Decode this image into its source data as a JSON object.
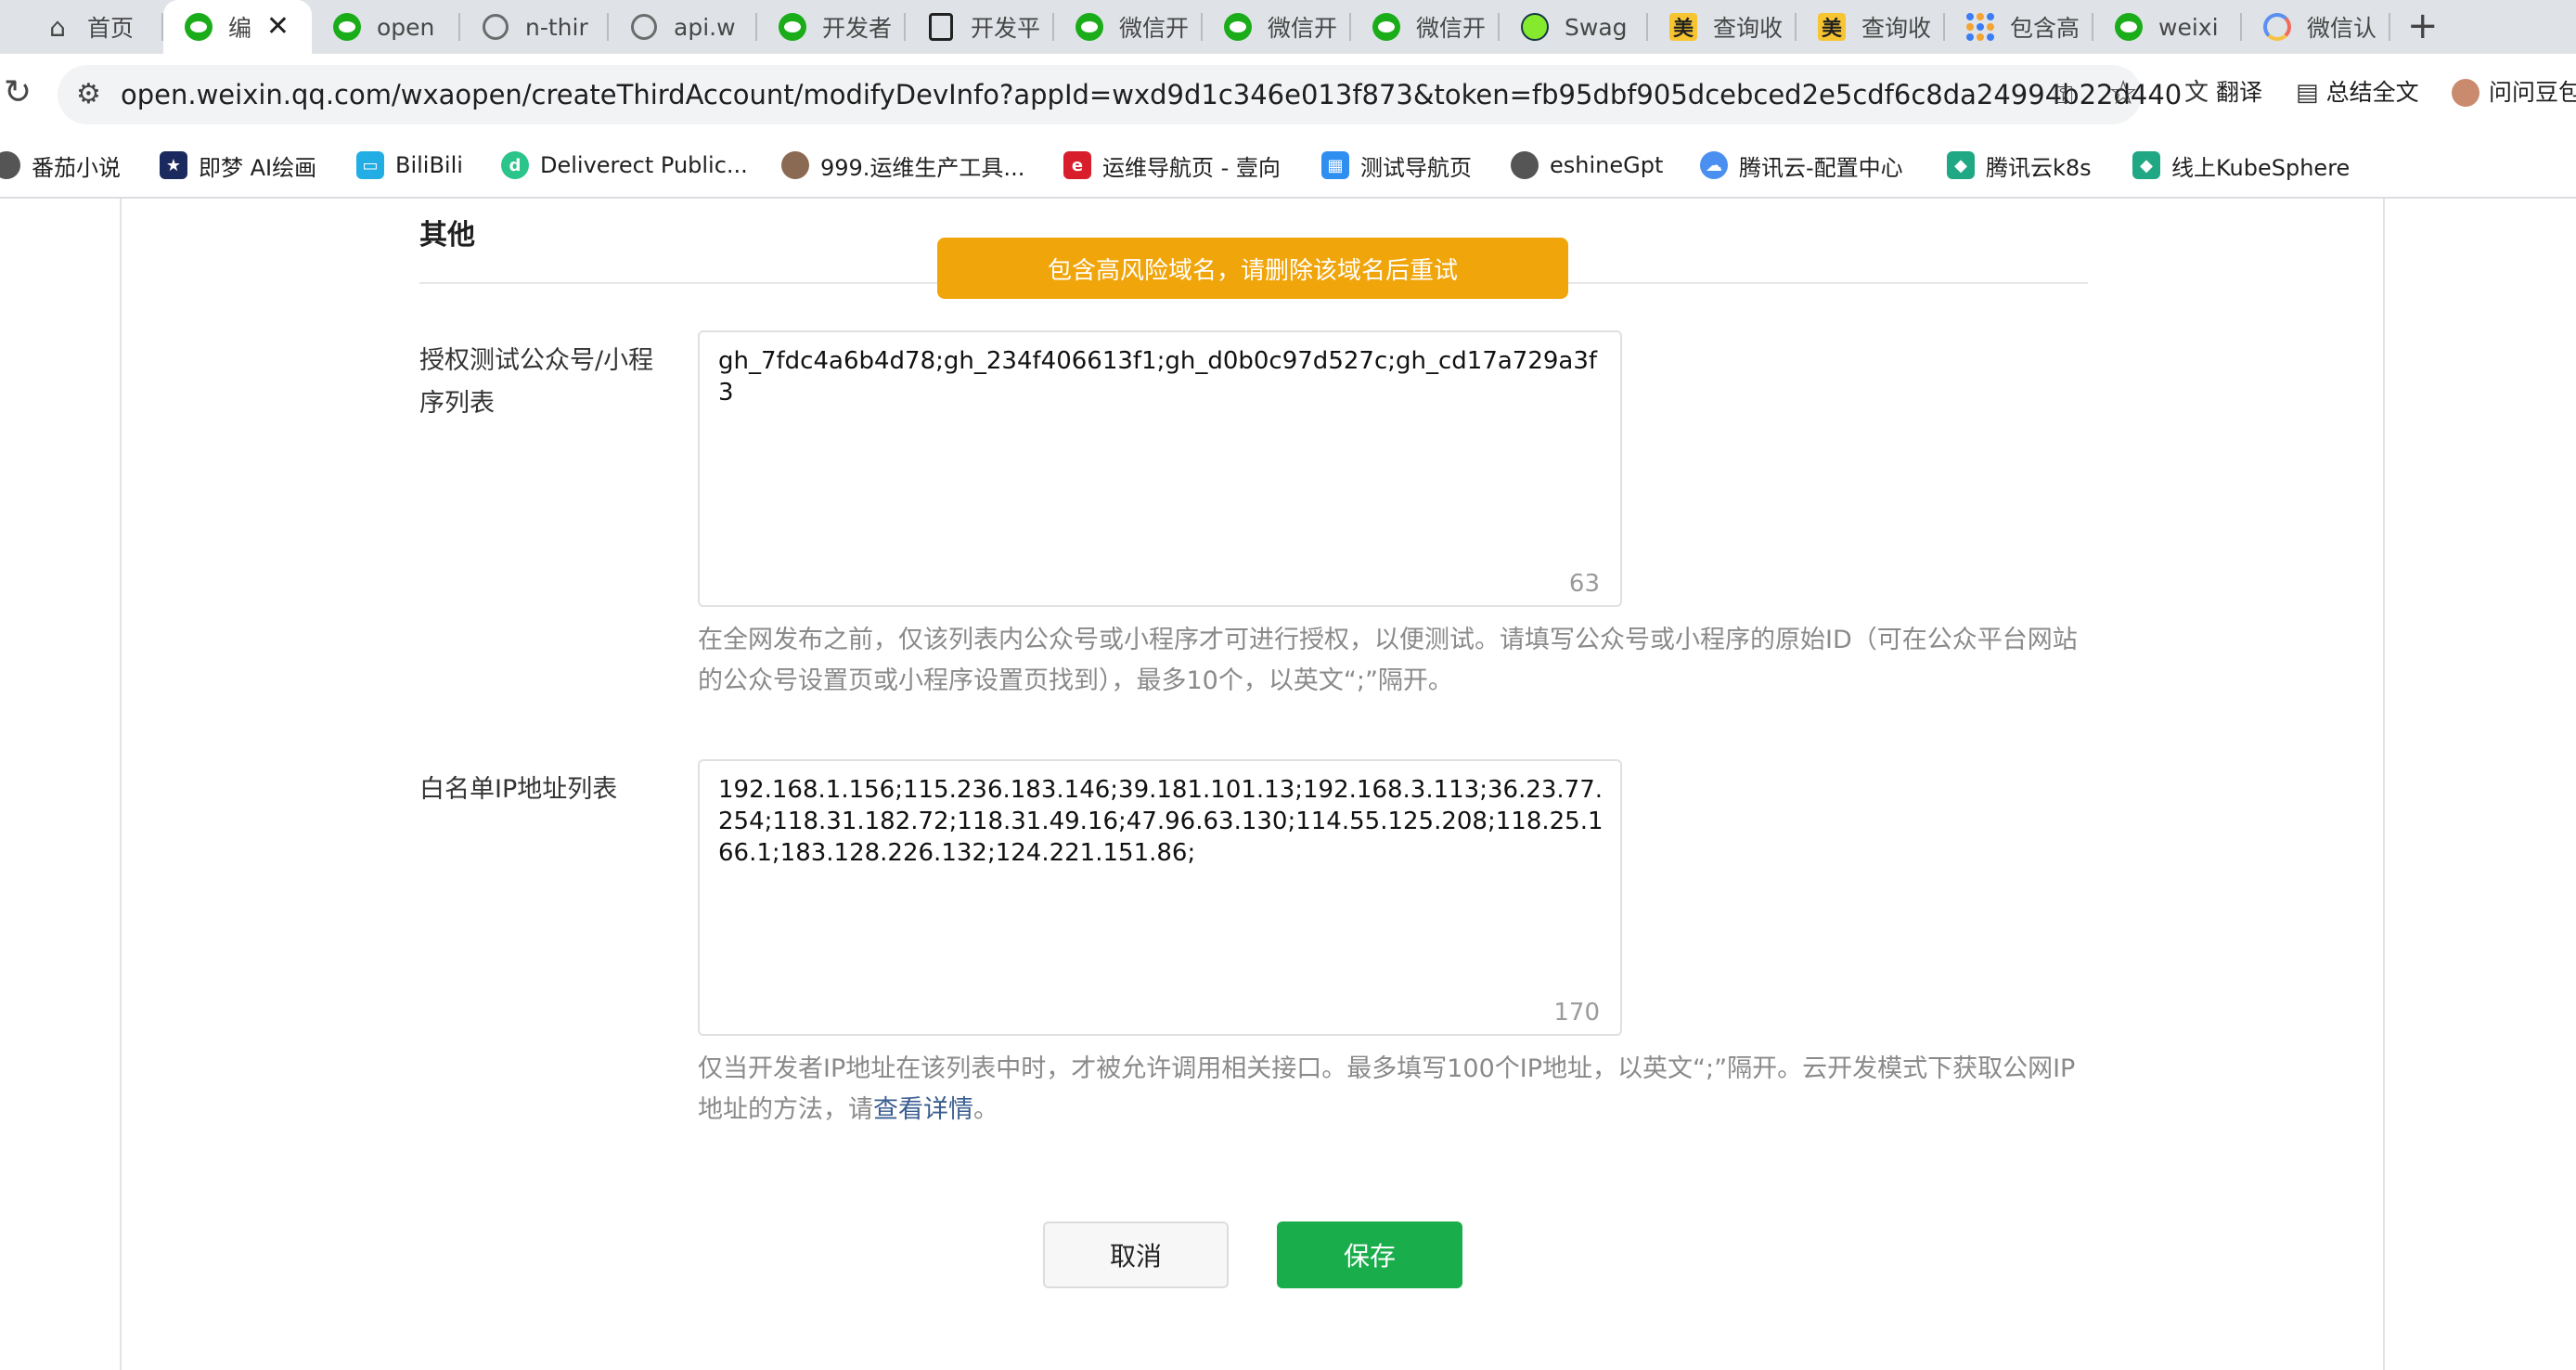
{
  "tabs": [
    {
      "title": "首页",
      "icon": "home-icon"
    },
    {
      "title": "编",
      "icon": "wechat-icon",
      "active": true
    },
    {
      "title": "open",
      "icon": "wechat-icon"
    },
    {
      "title": "n-thir",
      "icon": "globe-icon"
    },
    {
      "title": "api.w",
      "icon": "globe-icon"
    },
    {
      "title": "开发者",
      "icon": "wechat-icon"
    },
    {
      "title": "开发平",
      "icon": "cube-icon"
    },
    {
      "title": "微信开",
      "icon": "wechat-icon"
    },
    {
      "title": "微信开",
      "icon": "wechat-icon"
    },
    {
      "title": "微信开",
      "icon": "wechat-icon"
    },
    {
      "title": "Swag",
      "icon": "swagger-icon"
    },
    {
      "title": "查询收",
      "icon": "meituan-icon"
    },
    {
      "title": "查询收",
      "icon": "meituan-icon"
    },
    {
      "title": "包含高",
      "icon": "grid-icon"
    },
    {
      "title": "weixi",
      "icon": "wechat-icon"
    },
    {
      "title": "微信认",
      "icon": "ring-icon"
    }
  ],
  "toolbar": {
    "url": "open.weixin.qq.com/wxaopen/createThirdAccount/modifyDevInfo?appId=wxd9d1c346e013f873&token=fb95dbf905dcebced2e5cdf6c8da24994b22d440",
    "translate": "翻译",
    "summary": "总结全文",
    "ask": "问问豆包"
  },
  "bookmarks": [
    {
      "label": "番茄小说",
      "color": "#e8473d"
    },
    {
      "label": "即梦 AI绘画",
      "color": "#1b2a5e"
    },
    {
      "label": "BiliBili",
      "color": "#23ade5"
    },
    {
      "label": "Deliverect Public...",
      "color": "#2bc48a"
    },
    {
      "label": "999.运维生产工具...",
      "color": "#8a6a52"
    },
    {
      "label": "运维导航页 - 壹向",
      "color": "#d81e2a"
    },
    {
      "label": "测试导航页",
      "color": "#2f8ff0"
    },
    {
      "label": "eshineGpt",
      "color": "#555555"
    },
    {
      "label": "腾讯云-配置中心",
      "color": "#4b8ff0"
    },
    {
      "label": "腾讯云k8s",
      "color": "#1fa883"
    },
    {
      "label": "线上KubeSphere",
      "color": "#1fa883"
    }
  ],
  "page": {
    "section_title": "其他",
    "toast": "包含高风险域名，请删除该域名后重试",
    "field1": {
      "label": "授权测试公众号/小程序列表",
      "value": "gh_7fdc4a6b4d78;gh_234f406613f1;gh_d0b0c97d527c;gh_cd17a729a3f3",
      "count": "63",
      "hint": "在全网发布之前，仅该列表内公众号或小程序才可进行授权，以便测试。请填写公众号或小程序的原始ID（可在公众平台网站的公众号设置页或小程序设置页找到），最多10个，以英文“;”隔开。"
    },
    "field2": {
      "label": "白名单IP地址列表",
      "value": "192.168.1.156;115.236.183.146;39.181.101.13;192.168.3.113;36.23.77.254;118.31.182.72;118.31.49.16;47.96.63.130;114.55.125.208;118.25.166.1;183.128.226.132;124.221.151.86;",
      "count": "170",
      "hint_prefix": "仅当开发者IP地址在该列表中时，才被允许调用相关接口。最多填写100个IP地址，以英文“;”隔开。云开发模式下获取公网IP地址的方法，请",
      "hint_link": "查看详情",
      "hint_suffix": "。"
    },
    "cancel": "取消",
    "save": "保存"
  }
}
